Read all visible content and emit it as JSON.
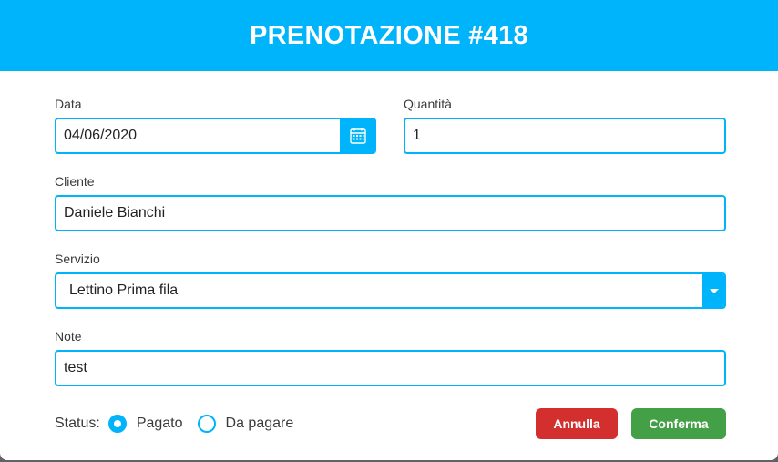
{
  "dialog": {
    "title": "PRENOTAZIONE #418"
  },
  "form": {
    "date": {
      "label": "Data",
      "value": "04/06/2020",
      "icon": "calendar-icon"
    },
    "quantity": {
      "label": "Quantità",
      "value": "1"
    },
    "client": {
      "label": "Cliente",
      "value": "Daniele Bianchi"
    },
    "service": {
      "label": "Servizio",
      "value": "Lettino Prima fila"
    },
    "notes": {
      "label": "Note",
      "value": "test"
    },
    "status": {
      "label": "Status:",
      "options": [
        {
          "label": "Pagato",
          "checked": true
        },
        {
          "label": "Da pagare",
          "checked": false
        }
      ]
    }
  },
  "actions": {
    "cancel_label": "Annulla",
    "confirm_label": "Conferma"
  },
  "colors": {
    "accent": "#00b4fb",
    "cancel": "#d32f2f",
    "confirm": "#43a047"
  }
}
